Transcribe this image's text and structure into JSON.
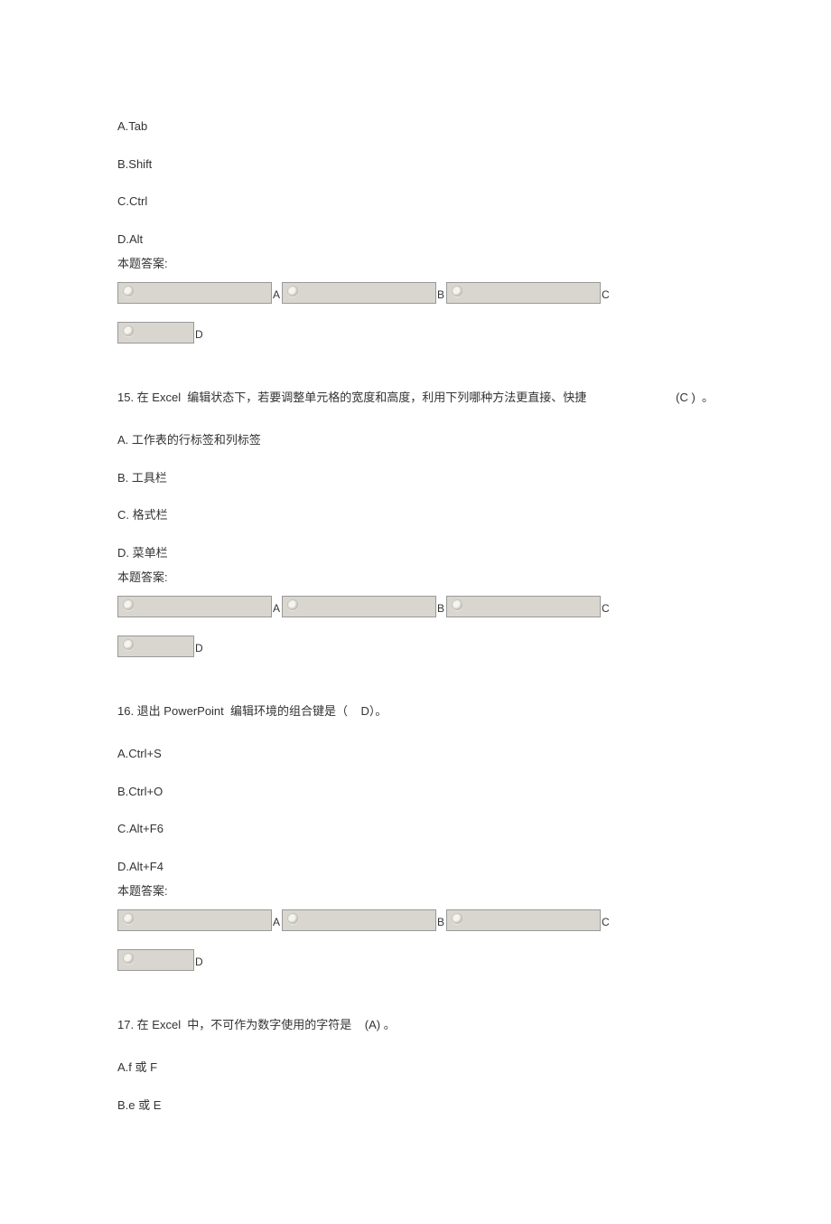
{
  "q14": {
    "options": {
      "a": "A.Tab",
      "b": "B.Shift",
      "c": "C.Ctrl",
      "d": "D.Alt"
    },
    "answer_label": "本题答案:",
    "letters": {
      "a": "A",
      "b": "B",
      "c": "C",
      "d": "D"
    }
  },
  "q15": {
    "prefix": "15. 在 Excel  编辑状态下，若要调整单元格的宽度和高度，利用下列哪种方法更直接、快捷",
    "suffix": "(C )  。",
    "options": {
      "a": "A. 工作表的行标签和列标签",
      "b": "B. 工具栏",
      "c": "C. 格式栏",
      "d": "D. 菜单栏"
    },
    "answer_label": "本题答案:",
    "letters": {
      "a": "A",
      "b": "B",
      "c": "C",
      "d": "D"
    }
  },
  "q16": {
    "text": "16. 退出 PowerPoint  编辑环境的组合键是（    D）。",
    "options": {
      "a": "A.Ctrl+S",
      "b": "B.Ctrl+O",
      "c": "C.Alt+F6",
      "d": "D.Alt+F4"
    },
    "answer_label": "本题答案:",
    "letters": {
      "a": "A",
      "b": "B",
      "c": "C",
      "d": "D"
    }
  },
  "q17": {
    "prefix": "17. 在 Excel  中，不可作为数字使用的字符是",
    "suffix": "(A) 。",
    "options": {
      "a": "A.f  或 F",
      "b": "B.e 或 E"
    }
  }
}
